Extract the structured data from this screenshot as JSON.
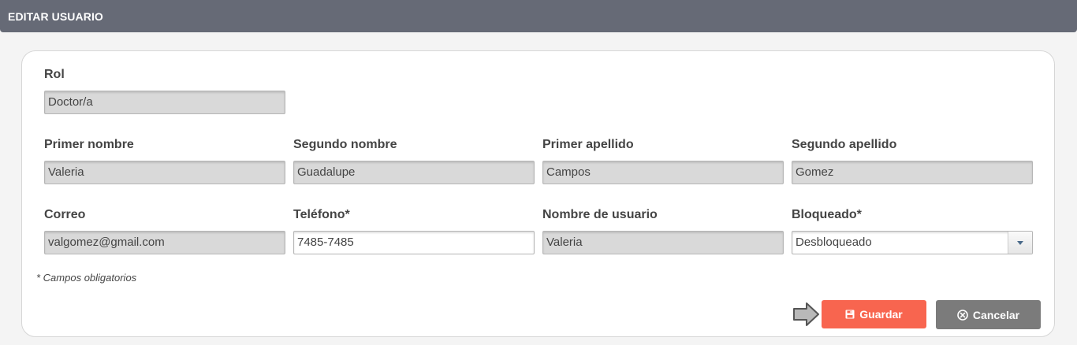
{
  "header": {
    "title": "EDITAR USUARIO"
  },
  "form": {
    "rol": {
      "label": "Rol",
      "value": "Doctor/a"
    },
    "primer_nombre": {
      "label": "Primer nombre",
      "value": "Valeria"
    },
    "segundo_nombre": {
      "label": "Segundo nombre",
      "value": "Guadalupe"
    },
    "primer_apellido": {
      "label": "Primer apellido",
      "value": "Campos"
    },
    "segundo_apellido": {
      "label": "Segundo apellido",
      "value": "Gomez"
    },
    "correo": {
      "label": "Correo",
      "value": "valgomez@gmail.com"
    },
    "telefono": {
      "label": "Teléfono*",
      "value": "7485-7485"
    },
    "nombre_usuario": {
      "label": "Nombre de usuario",
      "value": "Valeria"
    },
    "bloqueado": {
      "label": "Bloqueado*",
      "value": "Desbloqueado"
    },
    "required_note": "* Campos obligatorios"
  },
  "actions": {
    "save_label": "Guardar",
    "cancel_label": "Cancelar"
  },
  "colors": {
    "header_bg": "#666a76",
    "save_bg": "#f8654f",
    "cancel_bg": "#7b7b7b"
  },
  "icons": {
    "save": "floppy-disk-icon",
    "cancel": "circle-x-icon",
    "pointer": "arrow-right-icon",
    "dropdown": "caret-down-icon"
  }
}
